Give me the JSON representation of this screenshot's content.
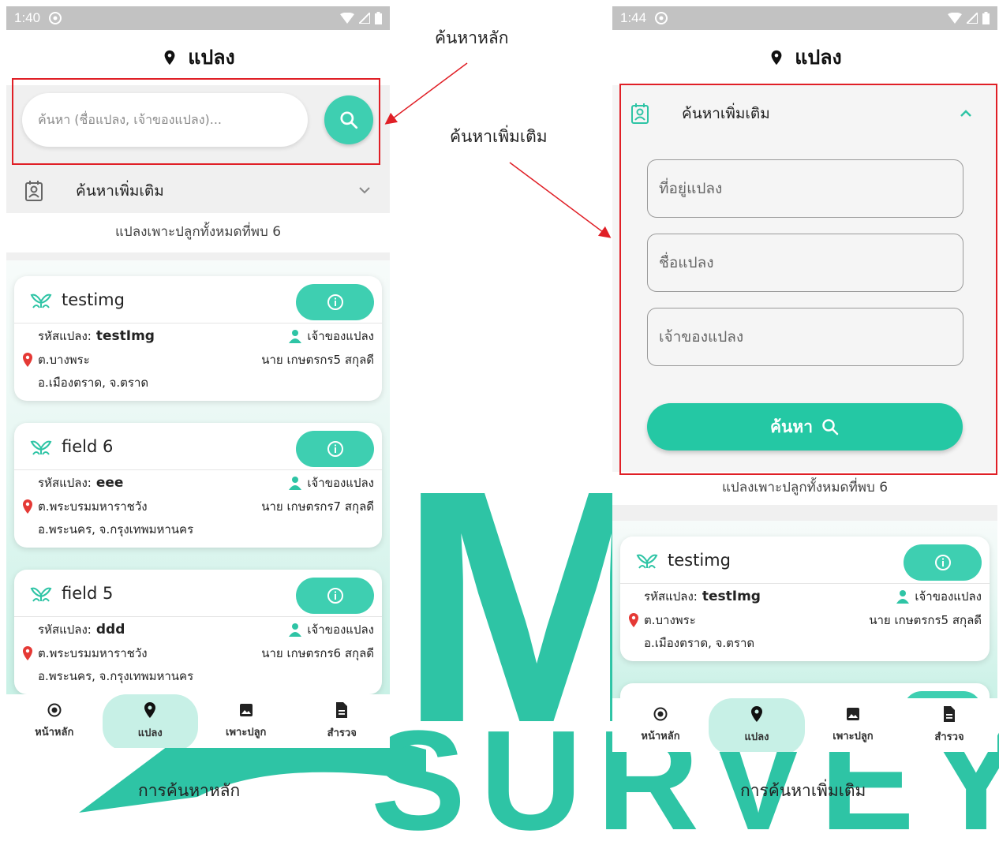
{
  "left_phone": {
    "status_time": "1:40",
    "title": "แปลง",
    "search_placeholder": "ค้นหา (ชื่อแปลง, เจ้าของแปลง)...",
    "advanced_label": "ค้นหาเพิ่มเติม",
    "count_text": "แปลงเพาะปลูกทั้งหมดที่พบ 6",
    "cards": [
      {
        "name": "testimg",
        "code_label": "รหัสแปลง:",
        "code": "testImg",
        "owner_label": "เจ้าของแปลง",
        "subdistrict": "ต.บางพระ",
        "owner": "นาย เกษตรกร5 สกุลดี",
        "district": "อ.เมืองตราด, จ.ตราด"
      },
      {
        "name": "field 6",
        "code_label": "รหัสแปลง:",
        "code": "eee",
        "owner_label": "เจ้าของแปลง",
        "subdistrict": "ต.พระบรมมหาราชวัง",
        "owner": "นาย เกษตรกร7 สกุลดี",
        "district": "อ.พระนคร, จ.กรุงเทพมหานคร"
      },
      {
        "name": "field 5",
        "code_label": "รหัสแปลง:",
        "code": "ddd",
        "owner_label": "เจ้าของแปลง",
        "subdistrict": "ต.พระบรมมหาราชวัง",
        "owner": "นาย เกษตรกร6 สกุลดี",
        "district": "อ.พระนคร, จ.กรุงเทพมหานคร"
      }
    ],
    "nav": [
      "หน้าหลัก",
      "แปลง",
      "เพาะปลูก",
      "สำรวจ"
    ],
    "caption": "การค้นหาหลัก"
  },
  "right_phone": {
    "status_time": "1:44",
    "title": "แปลง",
    "advanced_label": "ค้นหาเพิ่มเติม",
    "fields": [
      "ที่อยู่แปลง",
      "ชื่อแปลง",
      "เจ้าของแปลง"
    ],
    "search_button": "ค้นหา",
    "count_text": "แปลงเพาะปลูกทั้งหมดที่พบ 6",
    "card": {
      "name": "testimg",
      "code_label": "รหัสแปลง:",
      "code": "testImg",
      "owner_label": "เจ้าของแปลง",
      "subdistrict": "ต.บางพระ",
      "owner": "นาย เกษตรกร5 สกุลดี",
      "district": "อ.เมืองตราด, จ.ตราด"
    },
    "nav": [
      "หน้าหลัก",
      "แปลง",
      "เพาะปลูก",
      "สำรวจ"
    ],
    "caption": "การค้นหาเพิ่มเติม"
  },
  "annotations": {
    "main_search": "ค้นหาหลัก",
    "advanced_search": "ค้นหาเพิ่มเติม"
  },
  "watermark": {
    "big_letter": "M",
    "word": "SURVEY"
  },
  "colors": {
    "accent": "#3ecfb1",
    "highlight": "#e01f26",
    "statusbar": "#c2c2c2",
    "pin_red": "#e53935"
  },
  "icons": {
    "title": "map-pin-icon",
    "search": "search-icon",
    "advanced": "contact-card-icon",
    "card": "plant-sprout-icon",
    "info": "info-icon",
    "owner": "person-icon",
    "location": "location-pin-icon",
    "nav": [
      "radio-target-icon",
      "map-pin-icon",
      "image-icon",
      "document-icon"
    ]
  }
}
